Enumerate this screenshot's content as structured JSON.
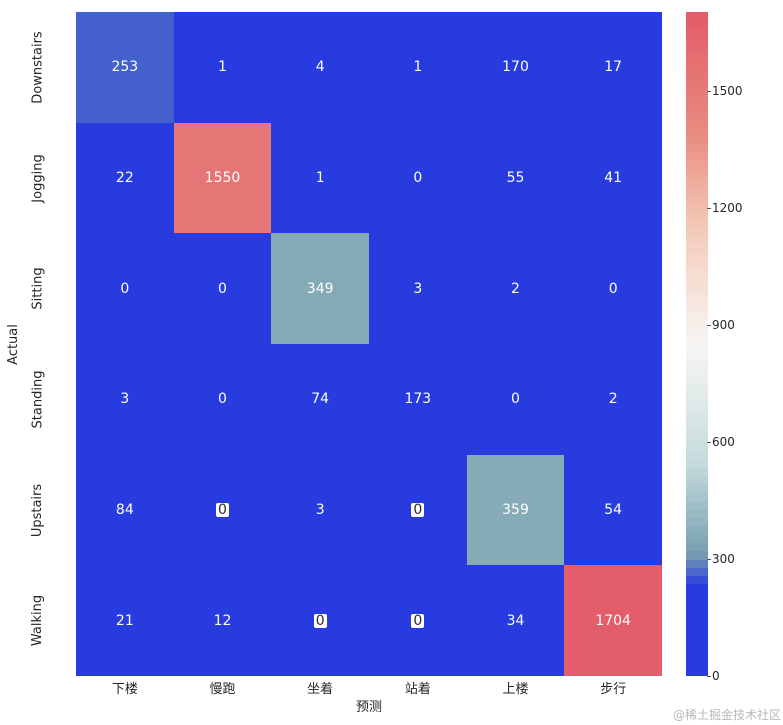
{
  "chart_data": {
    "type": "heatmap",
    "title": "",
    "xlabel": "预测",
    "ylabel": "Actual",
    "x_categories": [
      "下楼",
      "慢跑",
      "坐着",
      "站着",
      "上楼",
      "步行"
    ],
    "y_categories": [
      "Downstairs",
      "Jogging",
      "Sitting",
      "Standing",
      "Upstairs",
      "Walking"
    ],
    "matrix": [
      [
        253,
        1,
        4,
        1,
        170,
        17
      ],
      [
        22,
        1550,
        1,
        0,
        55,
        41
      ],
      [
        0,
        0,
        349,
        3,
        2,
        0
      ],
      [
        3,
        0,
        74,
        173,
        0,
        2
      ],
      [
        84,
        0,
        3,
        0,
        359,
        54
      ],
      [
        21,
        12,
        0,
        0,
        34,
        1704
      ]
    ],
    "colorbar": {
      "min": 0,
      "max": 1704,
      "ticks": [
        0,
        300,
        600,
        900,
        1200,
        1500
      ]
    }
  },
  "watermark": "@稀土掘金技术社区"
}
